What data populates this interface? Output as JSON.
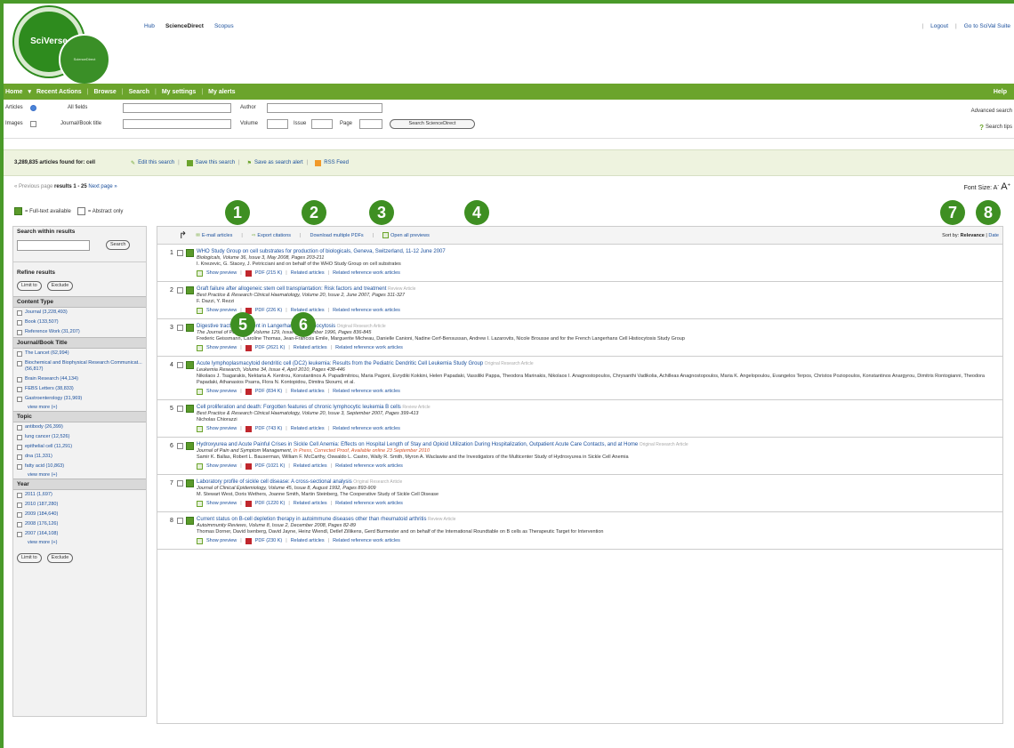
{
  "header": {
    "logo_main": "SciVerse",
    "logo_sub": "ScienceDirect",
    "links": [
      "Hub",
      "ScienceDirect",
      "Scopus"
    ],
    "right_links": [
      "Logout",
      "Go to SciVal Suite"
    ]
  },
  "nav": {
    "items": [
      "Home",
      "Recent Actions",
      "Browse",
      "Search",
      "My settings",
      "My alerts"
    ],
    "help": "Help"
  },
  "form": {
    "articles": "Articles",
    "images": "Images",
    "all_fields": "All fields",
    "all_fields_value": "",
    "author": "Author",
    "journal_title": "Journal/Book title",
    "volume": "Volume",
    "issue": "Issue",
    "page": "Page",
    "search_button": "Search ScienceDirect",
    "advanced": "Advanced search",
    "search_tips": "Search tips"
  },
  "results_bar": {
    "count": "3,289,835 articles found for: cell",
    "edit": "Edit this search",
    "save": "Save this search",
    "alert": "Save as search alert",
    "rss": "RSS Feed"
  },
  "pager": {
    "prev": "« Previous page",
    "current": "results 1 - 25",
    "next": "Next page »"
  },
  "font_size": {
    "label": "Font Size:",
    "small": "A",
    "big": "A"
  },
  "legend": {
    "full": "= Full-text available",
    "abstract": "= Abstract only"
  },
  "markers": [
    "1",
    "2",
    "3",
    "4",
    "5",
    "6",
    "7",
    "8"
  ],
  "sidebar": {
    "search_within": "Search within results",
    "search_button": "Search",
    "refine": "Refine results",
    "limit": "Limit to",
    "exclude": "Exclude",
    "sections": [
      {
        "title": "Content Type",
        "items": [
          "Journal (3,228,493)",
          "Book (133,507)",
          "Reference Work (31,207)"
        ],
        "more": ""
      },
      {
        "title": "Journal/Book Title",
        "items": [
          "The Lancet (62,994)",
          "Biochemical and Biophysical Research Communicat... (56,817)",
          "Brain Research (44,134)",
          "FEBS Letters (38,833)",
          "Gastroenterology (31,969)"
        ],
        "more": "view more (+)"
      },
      {
        "title": "Topic",
        "items": [
          "antibody (26,399)",
          "lung cancer (12,526)",
          "epithelial cell (11,291)",
          "dna (11,331)",
          "fatty acid (10,863)"
        ],
        "more": "view more (+)"
      },
      {
        "title": "Year",
        "items": [
          "2011 (1,697)",
          "2010 (187,280)",
          "2009 (184,640)",
          "2008 (176,126)",
          "2007 (164,108)"
        ],
        "more": "view more (+)"
      }
    ]
  },
  "toolbar": {
    "email": "E-mail articles",
    "export": "Export citations",
    "download": "Download multiple PDFs",
    "open": "Open all previews",
    "sort_label": "Sort by:",
    "sort_rel": "Relevance",
    "sort_date": "Date"
  },
  "results": [
    {
      "num": "1",
      "title": "WHO Study Group on cell substrates for production of biologicals, Geneva, Switzerland, 11-12 June 2007",
      "tag": "",
      "journal": "Biologicals, Volume 36, Issue 3, May 2008, Pages 203-211",
      "authors": "I. Knezevic, G. Stacey, J. Petricciani and on behalf of the WHO Study Group on cell substrates",
      "pdf": "PDF (215 K)"
    },
    {
      "num": "2",
      "title": "Graft failure after allogeneic stem cell transplantation: Risk factors and treatment",
      "tag": "Review Article",
      "journal": "Best Practice & Research Clinical Haematology, Volume 20, Issue 2, June 2007, Pages 311-327",
      "authors": "F. Dazzi, Y. Rezzi",
      "pdf": "PDF (226 K)"
    },
    {
      "num": "3",
      "title": "Digestive tract involvement in Langerhans cell histiocytosis",
      "tag": "Original Research Article",
      "journal": "The Journal of Pediatrics, Volume 129, Issue 6, December 1996, Pages 836-845",
      "authors": "Frederic Geissmann, Caroline Thomas, Jean-Francois Emile, Marguerite Micheau, Danielle Canioni, Nadine Cerf-Bensussan, Andrew I. Lazarovits, Nicole Brousse and for the French Langerhans Cell Histiocytosis Study Group",
      "pdf": "PDF (2621 K)"
    },
    {
      "num": "4",
      "title": "Acute lymphoplasmacytoid dendritic cell (DC2) leukemia: Results from the Pediatric Dendritic Cell Leukemia Study Group",
      "tag": "Original Research Article",
      "journal": "Leukemia Research, Volume 34, Issue 4, April 2010, Pages 438-446",
      "authors": "Nikolaos J. Tsagarakis, Nektaria A. Kentrou, Konstantinos A. Papadimitriou, Maria Pagoni, Evrydiki Kokkini, Helen Papadaki, Vassiliki Pappa, Theodora Marinakis, Nikolaos I. Anagnostopoulos, Chrysanthi Vadikolia, Achilleas Anagnostopoulos, Maria K. Angelopoulou, Evangelos Terpos, Christos Poziopoulos, Konstantinos Anargyrou, Dimitris Rontogianni, Theodora Papadaki, Athanasios Psarra, Flora N. Kontopidou, Dimitra Skoumi, et al.",
      "pdf": "PDF (834 K)"
    },
    {
      "num": "5",
      "title": "Cell proliferation and death: Forgotten features of chronic lymphocytic leukemia B cells",
      "tag": "Review Article",
      "journal": "Best Practice & Research Clinical Haematology, Volume 20, Issue 3, September 2007, Pages 399-413",
      "authors": "Nicholas Chiorazzi",
      "pdf": "PDF (743 K)"
    },
    {
      "num": "6",
      "title": "Hydroxyurea and Acute Painful Crises in Sickle Cell Anemia: Effects on Hospital Length of Stay and Opioid Utilization During Hospitalization, Outpatient Acute Care Contacts, and at Home",
      "tag": "Original Research Article",
      "journal": "Journal of Pain and Symptom Management,",
      "inpress": "In Press, Corrected Proof, Available online 23 September 2010",
      "authors": "Samir K. Ballas, Robert L. Bauserman, William F. McCarthy, Oswaldo L. Castro, Wally R. Smith, Myron A. Waclawiw and the Investigators of the Multicenter Study of Hydroxyurea in Sickle Cell Anemia",
      "pdf": "PDF (1021 K)"
    },
    {
      "num": "7",
      "title": "Laboratory profile of sickle cell disease: A cross-sectional analysis",
      "tag": "Original Research Article",
      "journal": "Journal of Clinical Epidemiology, Volume 45, Issue 8, August 1992, Pages 893-909",
      "authors": "M. Stewart West, Doris Wethers, Joanne Smith, Martin Steinberg, The Cooperative Study of Sickle Cell Disease",
      "pdf": "PDF (1220 K)"
    },
    {
      "num": "8",
      "title": "Current status on B-cell depletion therapy in autoimmune diseases other than rheumatoid arthritis",
      "tag": "Review Article",
      "journal": "Autoimmunity Reviews, Volume 8, Issue 2, December 2008, Pages 82-89",
      "authors": "Thomas Dorner, David Isenberg, David Jayne, Heinz Wiendl, Detlef Zillikens, Gerd Burmester and on behalf of the International Roundtable on B cells as Therapeutic Target for Intervention",
      "pdf": "PDF (230 K)"
    }
  ],
  "result_links": {
    "preview": "Show preview",
    "related": "Related articles",
    "related_ref": "Related reference work articles"
  },
  "colors": {
    "brand_green": "#6ba42c",
    "marker_green": "#3e8f22",
    "link_blue": "#1a4f9c"
  }
}
